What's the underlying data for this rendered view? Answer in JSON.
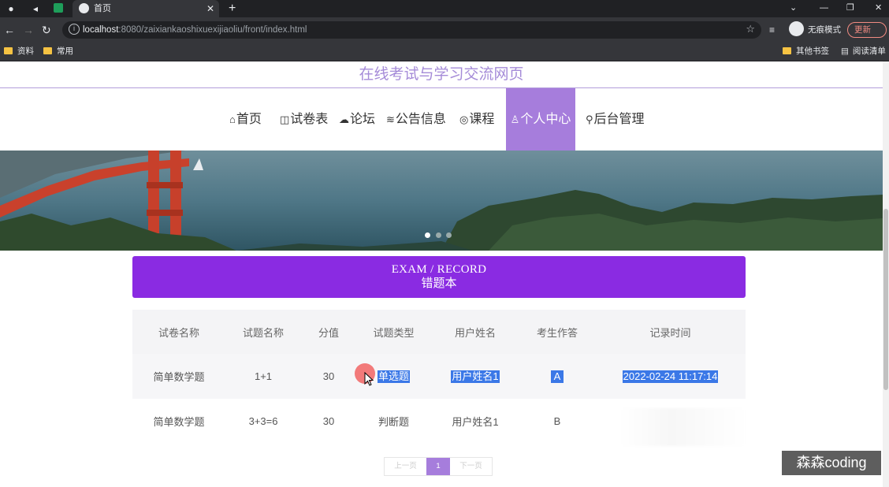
{
  "browser": {
    "tab_title": "首页",
    "url_host": "localhost",
    "url_rest": ":8080/zaixiankaoshixuexijiaoliu/front/index.html",
    "incognito_label": "无痕模式",
    "update_label": "更新",
    "bookmarks": [
      "资料",
      "常用"
    ],
    "bookmarks_right": [
      "其他书签",
      "阅读清单"
    ]
  },
  "site": {
    "title": "在线考试与学习交流网页",
    "nav": [
      {
        "icon": "home-icon",
        "label": "首页"
      },
      {
        "icon": "exam-icon",
        "label": "试卷表"
      },
      {
        "icon": "forum-icon",
        "label": "论坛"
      },
      {
        "icon": "layers-icon",
        "label": "公告信息"
      },
      {
        "icon": "course-icon",
        "label": "课程"
      },
      {
        "icon": "user-icon",
        "label": "个人中心"
      },
      {
        "icon": "link-icon",
        "label": "后台管理"
      }
    ],
    "active_nav": "个人中心"
  },
  "section": {
    "en": "EXAM / RECORD",
    "cn": "错题本"
  },
  "table": {
    "headers": [
      "试卷名称",
      "试题名称",
      "分值",
      "试题类型",
      "用户姓名",
      "考生作答",
      "记录时间"
    ],
    "rows": [
      [
        "简单数学题",
        "1+1",
        "30",
        "单选题",
        "用户姓名1",
        "A",
        "2022-02-24 11:17:14"
      ],
      [
        "简单数学题",
        "3+3=6",
        "30",
        "判断题",
        "用户姓名1",
        "B",
        ""
      ]
    ]
  },
  "pagination": {
    "prev": "上一页",
    "current": "1",
    "next": "下一页"
  },
  "watermark": "森森coding",
  "colors": {
    "accent": "#8a2be2",
    "nav_active": "#a67ddc",
    "title": "#a58bd8",
    "selection": "#3b78e7"
  }
}
